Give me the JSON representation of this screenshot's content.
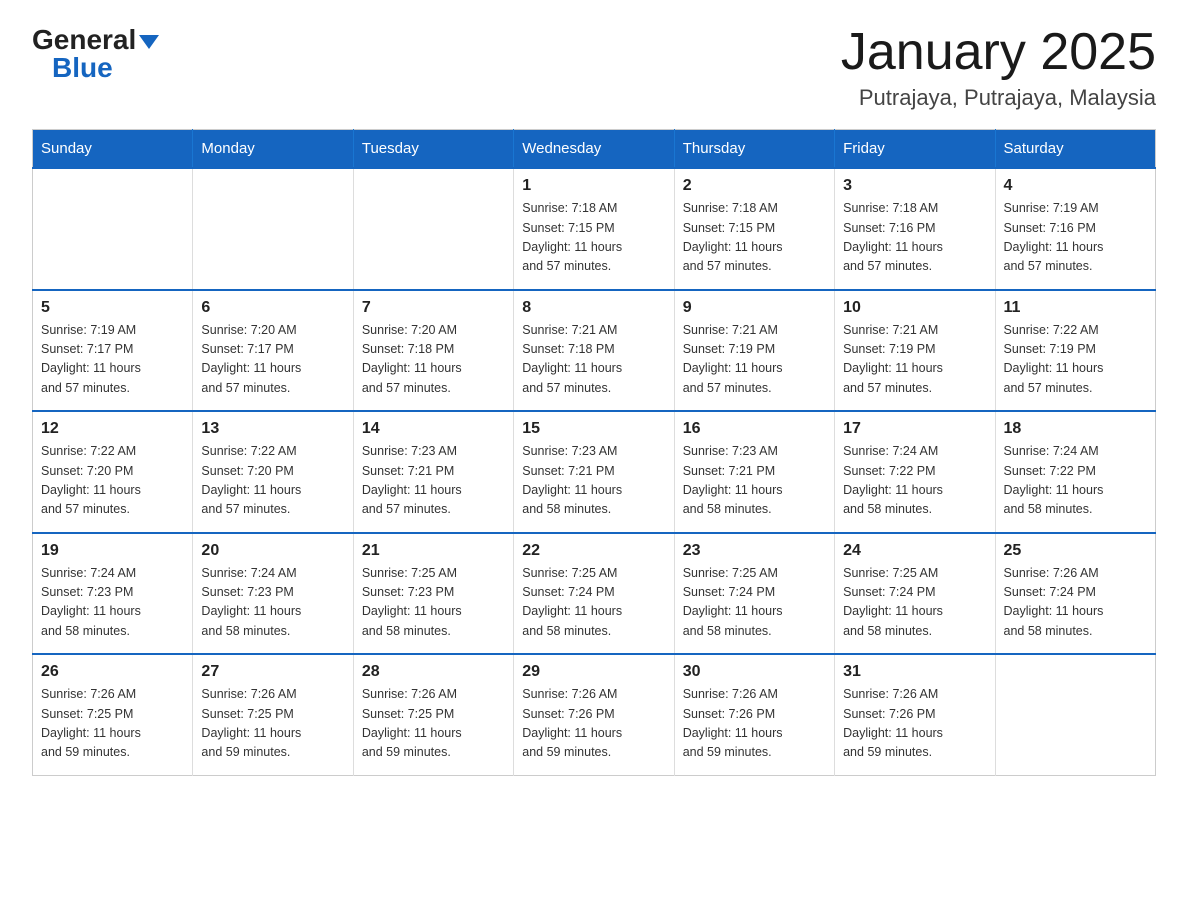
{
  "header": {
    "logo_general": "General",
    "logo_blue": "Blue",
    "title": "January 2025",
    "subtitle": "Putrajaya, Putrajaya, Malaysia"
  },
  "days_of_week": [
    "Sunday",
    "Monday",
    "Tuesday",
    "Wednesday",
    "Thursday",
    "Friday",
    "Saturday"
  ],
  "weeks": [
    [
      {
        "day": "",
        "info": ""
      },
      {
        "day": "",
        "info": ""
      },
      {
        "day": "",
        "info": ""
      },
      {
        "day": "1",
        "info": "Sunrise: 7:18 AM\nSunset: 7:15 PM\nDaylight: 11 hours\nand 57 minutes."
      },
      {
        "day": "2",
        "info": "Sunrise: 7:18 AM\nSunset: 7:15 PM\nDaylight: 11 hours\nand 57 minutes."
      },
      {
        "day": "3",
        "info": "Sunrise: 7:18 AM\nSunset: 7:16 PM\nDaylight: 11 hours\nand 57 minutes."
      },
      {
        "day": "4",
        "info": "Sunrise: 7:19 AM\nSunset: 7:16 PM\nDaylight: 11 hours\nand 57 minutes."
      }
    ],
    [
      {
        "day": "5",
        "info": "Sunrise: 7:19 AM\nSunset: 7:17 PM\nDaylight: 11 hours\nand 57 minutes."
      },
      {
        "day": "6",
        "info": "Sunrise: 7:20 AM\nSunset: 7:17 PM\nDaylight: 11 hours\nand 57 minutes."
      },
      {
        "day": "7",
        "info": "Sunrise: 7:20 AM\nSunset: 7:18 PM\nDaylight: 11 hours\nand 57 minutes."
      },
      {
        "day": "8",
        "info": "Sunrise: 7:21 AM\nSunset: 7:18 PM\nDaylight: 11 hours\nand 57 minutes."
      },
      {
        "day": "9",
        "info": "Sunrise: 7:21 AM\nSunset: 7:19 PM\nDaylight: 11 hours\nand 57 minutes."
      },
      {
        "day": "10",
        "info": "Sunrise: 7:21 AM\nSunset: 7:19 PM\nDaylight: 11 hours\nand 57 minutes."
      },
      {
        "day": "11",
        "info": "Sunrise: 7:22 AM\nSunset: 7:19 PM\nDaylight: 11 hours\nand 57 minutes."
      }
    ],
    [
      {
        "day": "12",
        "info": "Sunrise: 7:22 AM\nSunset: 7:20 PM\nDaylight: 11 hours\nand 57 minutes."
      },
      {
        "day": "13",
        "info": "Sunrise: 7:22 AM\nSunset: 7:20 PM\nDaylight: 11 hours\nand 57 minutes."
      },
      {
        "day": "14",
        "info": "Sunrise: 7:23 AM\nSunset: 7:21 PM\nDaylight: 11 hours\nand 57 minutes."
      },
      {
        "day": "15",
        "info": "Sunrise: 7:23 AM\nSunset: 7:21 PM\nDaylight: 11 hours\nand 58 minutes."
      },
      {
        "day": "16",
        "info": "Sunrise: 7:23 AM\nSunset: 7:21 PM\nDaylight: 11 hours\nand 58 minutes."
      },
      {
        "day": "17",
        "info": "Sunrise: 7:24 AM\nSunset: 7:22 PM\nDaylight: 11 hours\nand 58 minutes."
      },
      {
        "day": "18",
        "info": "Sunrise: 7:24 AM\nSunset: 7:22 PM\nDaylight: 11 hours\nand 58 minutes."
      }
    ],
    [
      {
        "day": "19",
        "info": "Sunrise: 7:24 AM\nSunset: 7:23 PM\nDaylight: 11 hours\nand 58 minutes."
      },
      {
        "day": "20",
        "info": "Sunrise: 7:24 AM\nSunset: 7:23 PM\nDaylight: 11 hours\nand 58 minutes."
      },
      {
        "day": "21",
        "info": "Sunrise: 7:25 AM\nSunset: 7:23 PM\nDaylight: 11 hours\nand 58 minutes."
      },
      {
        "day": "22",
        "info": "Sunrise: 7:25 AM\nSunset: 7:24 PM\nDaylight: 11 hours\nand 58 minutes."
      },
      {
        "day": "23",
        "info": "Sunrise: 7:25 AM\nSunset: 7:24 PM\nDaylight: 11 hours\nand 58 minutes."
      },
      {
        "day": "24",
        "info": "Sunrise: 7:25 AM\nSunset: 7:24 PM\nDaylight: 11 hours\nand 58 minutes."
      },
      {
        "day": "25",
        "info": "Sunrise: 7:26 AM\nSunset: 7:24 PM\nDaylight: 11 hours\nand 58 minutes."
      }
    ],
    [
      {
        "day": "26",
        "info": "Sunrise: 7:26 AM\nSunset: 7:25 PM\nDaylight: 11 hours\nand 59 minutes."
      },
      {
        "day": "27",
        "info": "Sunrise: 7:26 AM\nSunset: 7:25 PM\nDaylight: 11 hours\nand 59 minutes."
      },
      {
        "day": "28",
        "info": "Sunrise: 7:26 AM\nSunset: 7:25 PM\nDaylight: 11 hours\nand 59 minutes."
      },
      {
        "day": "29",
        "info": "Sunrise: 7:26 AM\nSunset: 7:26 PM\nDaylight: 11 hours\nand 59 minutes."
      },
      {
        "day": "30",
        "info": "Sunrise: 7:26 AM\nSunset: 7:26 PM\nDaylight: 11 hours\nand 59 minutes."
      },
      {
        "day": "31",
        "info": "Sunrise: 7:26 AM\nSunset: 7:26 PM\nDaylight: 11 hours\nand 59 minutes."
      },
      {
        "day": "",
        "info": ""
      }
    ]
  ]
}
